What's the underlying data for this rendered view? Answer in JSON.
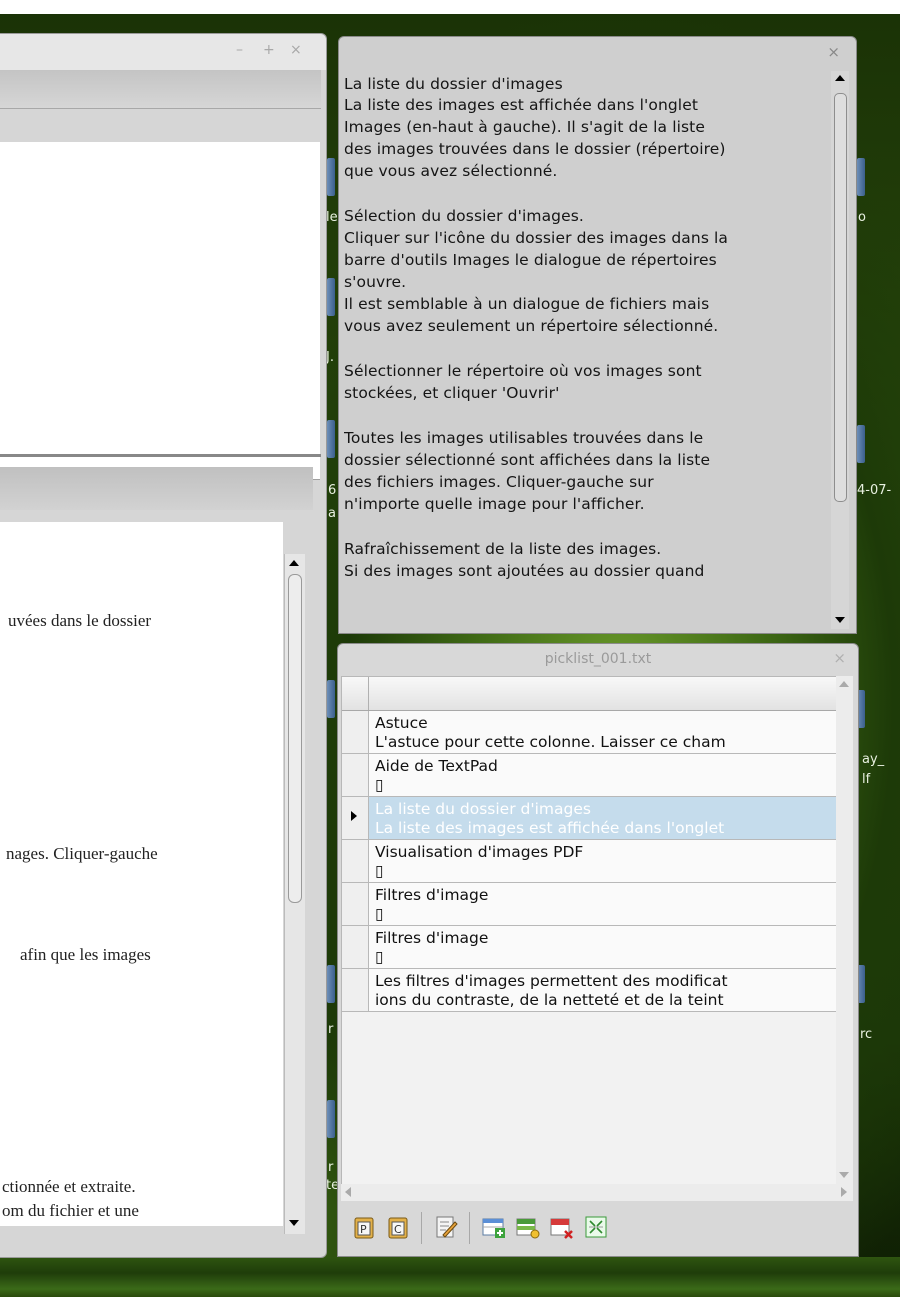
{
  "left_window": {
    "controls": {
      "minimize": "–",
      "maximize": "+",
      "close": "×"
    },
    "visible_text_lines": [
      "uvées dans le dossier",
      "nages. Cliquer-gauche",
      "afin que les images",
      "ctionnée et extraite.",
      "om du fichier et une"
    ]
  },
  "help_popup": {
    "close": "×",
    "lines": [
      "La liste du dossier d'images",
      "La liste des images est affichée dans l'onglet",
      "Images (en-haut à gauche). Il s'agit de la liste",
      "des images trouvées dans le dossier (répertoire)",
      "que vous avez sélectionné.",
      "",
      "Sélection du dossier d'images.",
      "Cliquer sur l'icône du dossier des images dans la",
      "barre d'outils Images le dialogue de répertoires",
      "s'ouvre.",
      "Il est semblable à un dialogue de fichiers mais",
      "vous avez seulement un répertoire sélectionné.",
      "",
      "Sélectionner le répertoire où vos images sont",
      "stockées, et cliquer 'Ouvrir'",
      "",
      "Toutes les images utilisables trouvées dans le",
      "dossier sélectionné sont affichées dans la liste",
      "des fichiers images. Cliquer-gauche sur",
      "n'importe quelle image pour l'afficher.",
      "",
      "Rafraîchissement de la liste des images.",
      "Si des images sont ajoutées au dossier quand"
    ]
  },
  "picklist": {
    "title": "picklist_001.txt",
    "close": "×",
    "rows": [
      {
        "line1": "Astuce",
        "line2": "L'astuce pour cette colonne. Laisser ce cham",
        "selected": false
      },
      {
        "line1": "Aide de TextPad",
        "line2": "▯",
        "selected": false
      },
      {
        "line1": "La liste du dossier d'images",
        "line2": "La liste des images est affichée dans l'onglet",
        "selected": true
      },
      {
        "line1": "Visualisation d'images PDF",
        "line2": "▯",
        "selected": false
      },
      {
        "line1": "Filtres d'image",
        "line2": "▯",
        "selected": false
      },
      {
        "line1": "Filtres d'image",
        "line2": "▯",
        "selected": false
      },
      {
        "line1": "Les filtres d'images permettent des modificat",
        "line2": "ions du contraste, de la netteté et de la teint",
        "selected": false
      }
    ],
    "toolbar": [
      "paste-p-icon",
      "paste-c-icon",
      "edit-icon",
      "add-row-icon",
      "insert-row-icon",
      "delete-row-icon",
      "fit-icon"
    ]
  },
  "desktop_labels": {
    "l1": "le",
    "l2": "o",
    "l3": "J.",
    "l4": "6",
    "l5": "a",
    "l6": "4-07-",
    "l7": "ay_",
    "l8": "lf",
    "l9": "r",
    "l10": "rc",
    "l11": "r",
    "l12": "te"
  },
  "colors": {
    "selection": "#c5dcec",
    "window_bg": "#d8d8d8",
    "desktop_green": "#3f6a15"
  }
}
